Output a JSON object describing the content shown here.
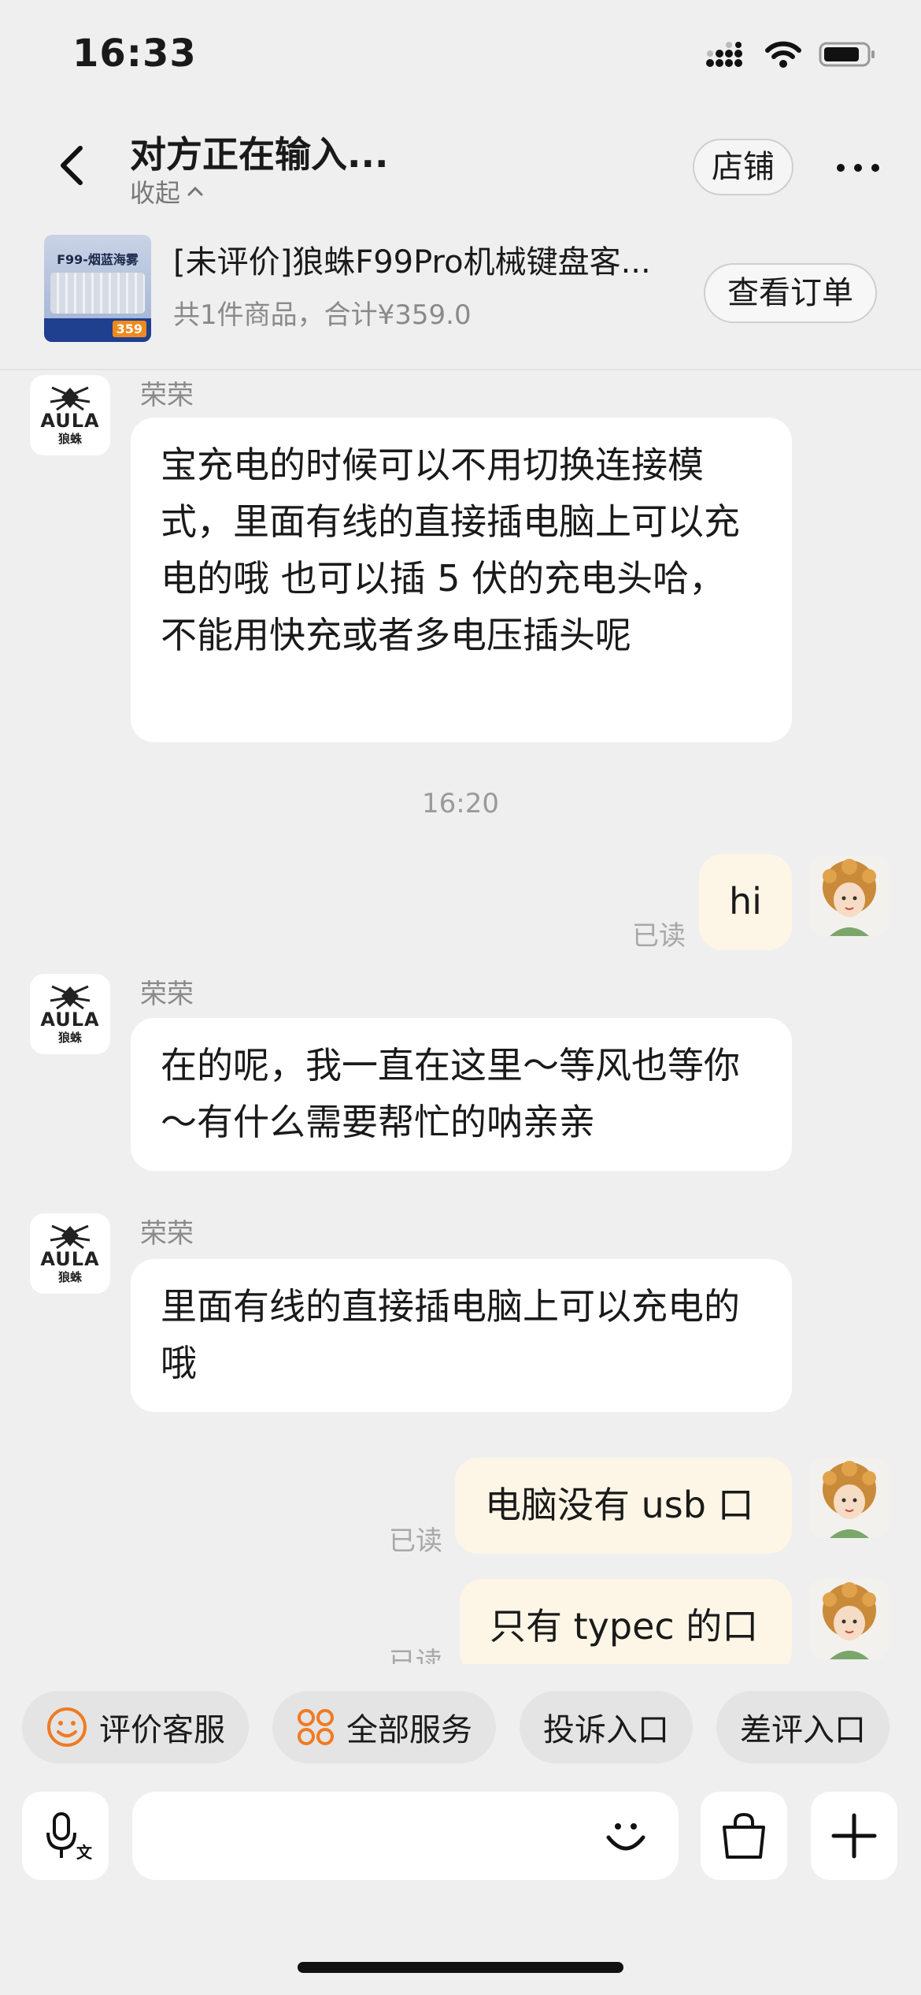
{
  "status_bar": {
    "time": "16:33"
  },
  "nav": {
    "title": "对方正在输入...",
    "collapse_label": "收起",
    "shop_label": "店铺"
  },
  "order": {
    "product_title": "[未评价]狼蛛F99Pro机械键盘客...",
    "summary": "共1件商品，合计¥359.0",
    "view_order_label": "查看订单",
    "thumb_label": "F99-烟蓝海雾",
    "thumb_price": "359"
  },
  "shop_avatar": {
    "logo_text": "AULA",
    "logo_cn": "狼蛛"
  },
  "messages": [
    {
      "sender": "荣荣",
      "text": "宝充电的时候可以不用切换连接模式，里面有线的直接插电脑上可以充电的哦 也可以插 5 伏的充电头哈， 不能用快充或者多电压插头呢"
    },
    {
      "time": "16:20"
    },
    {
      "self": true,
      "text": "hi",
      "read": "已读"
    },
    {
      "sender": "荣荣",
      "text": "在的呢，我一直在这里～等风也等你～有什么需要帮忙的呐亲亲"
    },
    {
      "sender": "荣荣",
      "text": "里面有线的直接插电脑上可以充电的哦"
    },
    {
      "self": true,
      "text": "电脑没有 usb 口",
      "read": "已读"
    },
    {
      "self": true,
      "text": "只有 typec 的口",
      "read": "已读"
    }
  ],
  "quick_actions": [
    {
      "label": "评价客服",
      "icon": "smile-icon"
    },
    {
      "label": "全部服务",
      "icon": "grid-icon"
    },
    {
      "label": "投诉入口"
    },
    {
      "label": "差评入口"
    }
  ],
  "input": {
    "placeholder": ""
  },
  "colors": {
    "self_bubble": "#fdf6e6",
    "accent": "#f07a22",
    "background": "#efefef"
  }
}
